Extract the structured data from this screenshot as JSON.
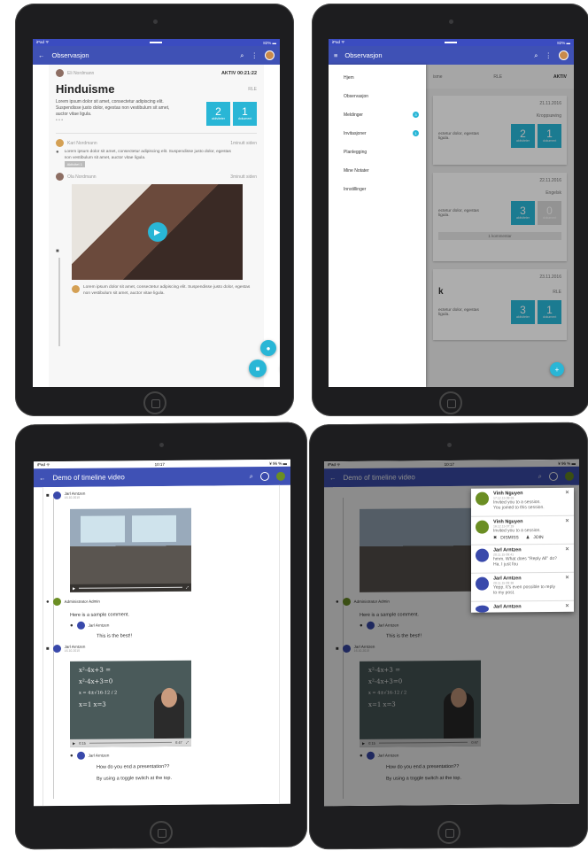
{
  "colors": {
    "primary": "#3f51b5",
    "accent": "#29b6d6"
  },
  "s1": {
    "status": {
      "left": "iPad ᯤ",
      "right": "82% ▬"
    },
    "title": "Observasjon",
    "author": "Eli Nordmann",
    "timer": "AKTIV 00:21:22",
    "heading": "Hinduisme",
    "subject": "RLE",
    "body": "Lorem ipsum dolor sit amet, consectetur adipiscing elit. Suspendisse justo dolor, egestas non vestibulum sit amet, auctor vitae ligula.",
    "dots": "• • •",
    "tiles": [
      {
        "n": "2",
        "l": "aktiviteter"
      },
      {
        "n": "1",
        "l": "dokument"
      }
    ],
    "c1": {
      "name": "Kari Nordmann",
      "time": "1minutt siden",
      "text": "Lorem ipsum dolor sit amet, consectetur adipiscing elit. Suspendisse justo dolor, egestas non vestibulum sit amet, auctor vitae ligula.",
      "tag": "Aktivitet 1"
    },
    "c2": {
      "name": "Ola Nordmann",
      "time": "3minutt siden"
    },
    "c3": {
      "text": "Lorem ipsum dolor sit amet, consectetur adipiscing elit. Suspendisse justo dolor, egestas non vestibulum sit amet, auctor vitae ligula."
    }
  },
  "s2": {
    "title": "Observasjon",
    "menu": [
      {
        "label": "Hjem"
      },
      {
        "label": "Observasjon"
      },
      {
        "label": "Meldinger",
        "badge": "3"
      },
      {
        "label": "Invitasjoner",
        "badge": "1"
      },
      {
        "label": "Planlegging"
      },
      {
        "label": "Mine Notater"
      },
      {
        "label": "Innstillinger"
      }
    ],
    "tabs": {
      "t1": "isme",
      "t2": "RLE",
      "t3": "AKTIV"
    },
    "cards": [
      {
        "date": "21.11.2016",
        "subject": "Kroppsøving",
        "text": "ectetur dolor, egestas ligula.",
        "tiles": [
          "2",
          "1"
        ]
      },
      {
        "date": "22.11.2016",
        "subject": "Engelsk",
        "text": "ectetur dolor, egestas ligula.",
        "tiles": [
          "3",
          "0"
        ],
        "comment": "1 kommentar"
      },
      {
        "date": "23.11.2016",
        "subject": "RLE",
        "letter": "k",
        "text": "ectetur dolor, egestas ligula.",
        "tiles": [
          "3",
          "1"
        ]
      }
    ],
    "tile_labels": [
      "aktiviteter",
      "dokument"
    ]
  },
  "s3": {
    "status": {
      "left": "iPad ᯤ",
      "time": "10:17",
      "right": "¥ 96 % ▬"
    },
    "title": "Demo of timeline video",
    "e1": {
      "name": "Jarl Arntzen",
      "date": "16.10.2015"
    },
    "e2": {
      "name": "Administrator Admin",
      "date": "16.10.2015",
      "text": "Here is a sample comment."
    },
    "e2r": {
      "name": "Jarl Arntzen",
      "text": "This is the best!!"
    },
    "e3": {
      "name": "Jarl Arntzen",
      "date": "16.10.2015",
      "time1": "0:15",
      "time2": "0:47"
    },
    "e4": {
      "name": "Jarl Arntzen",
      "text": "How do you end a presentation??",
      "text2": "By using a toggle switch at the top."
    },
    "board": {
      "l1": "x²-4x+3 =",
      "l2": "x²-4x+3=0",
      "l3": "x = 4±√16-12 / 2",
      "l4": "x=1    x=3"
    }
  },
  "s4": {
    "notifications": [
      {
        "name": "Vinh Nguyen",
        "time": "17.12.15 08:33",
        "l1": "Invited you to a session.",
        "l2": "You joined to this session."
      },
      {
        "name": "Vinh Nguyen",
        "time": "16.12.15 07:19",
        "l1": "Invited you to a session.",
        "dismiss": "DISMISS",
        "join": "JOIN"
      },
      {
        "name": "Jarl Arntzen",
        "time": "20.11.15 09:41",
        "l1": "hmm. What does \"Reply All\" do?",
        "l2": "Ha. I just fou"
      },
      {
        "name": "Jarl Arntzen",
        "time": "20.11.15 09:38",
        "l1": "Yepp. It's even possible to reply",
        "l2": "to my post."
      },
      {
        "name": "Jarl Arntzen",
        "time": ""
      }
    ]
  }
}
